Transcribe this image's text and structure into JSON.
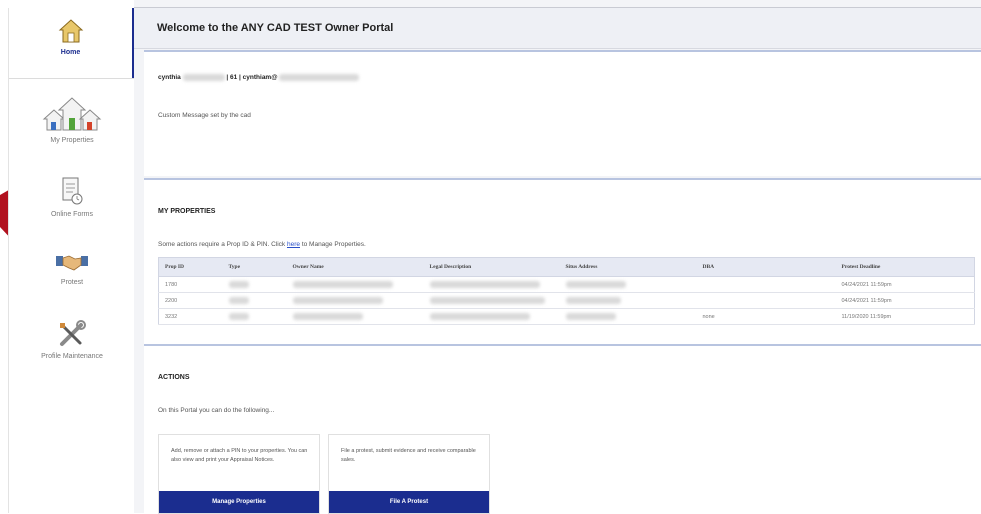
{
  "sidebar": {
    "items": [
      {
        "label": "Home",
        "icon": "home-icon"
      },
      {
        "label": "My Properties",
        "icon": "houses-icon"
      },
      {
        "label": "Online Forms",
        "icon": "forms-icon"
      },
      {
        "label": "Protest",
        "icon": "handshake-icon"
      },
      {
        "label": "Profile Maintenance",
        "icon": "tools-icon"
      }
    ]
  },
  "header": {
    "title": "Welcome to the ANY CAD TEST Owner Portal"
  },
  "user": {
    "name": "cynthia",
    "mid": "| 61 | cynthiam@",
    "message": "Custom Message set by the cad"
  },
  "properties": {
    "title": "MY PROPERTIES",
    "note_before": "Some actions require a Prop ID & PIN. Click",
    "note_link": "here",
    "note_after": "to Manage Properties.",
    "columns": [
      "Prop ID",
      "Type",
      "Owner Name",
      "Legal Description",
      "Situs Address",
      "DBA",
      "Protest Deadline"
    ],
    "rows": [
      {
        "prop_id": "1780",
        "type": "",
        "owner": "",
        "legal": "",
        "situs": "",
        "dba": "",
        "deadline": "04/24/2021 11:59pm"
      },
      {
        "prop_id": "2200",
        "type": "",
        "owner": "",
        "legal": "",
        "situs": "",
        "dba": "",
        "deadline": "04/24/2021 11:59pm"
      },
      {
        "prop_id": "3232",
        "type": "",
        "owner": "",
        "legal": "",
        "situs": "",
        "dba": "none",
        "deadline": "11/19/2020 11:59pm"
      }
    ]
  },
  "actions": {
    "title": "ACTIONS",
    "intro": "On this Portal you can do the following...",
    "cards": [
      {
        "text": "Add, remove or attach a PIN to your properties. You can also view and print your Appraisal Notices.",
        "button": "Manage Properties"
      },
      {
        "text": "File a protest, submit evidence and receive comparable sales.",
        "button": "File A Protest"
      }
    ]
  },
  "colors": {
    "accent": "#1b2d8f",
    "ribbon": "#b1121f",
    "link": "#2a50c8"
  }
}
